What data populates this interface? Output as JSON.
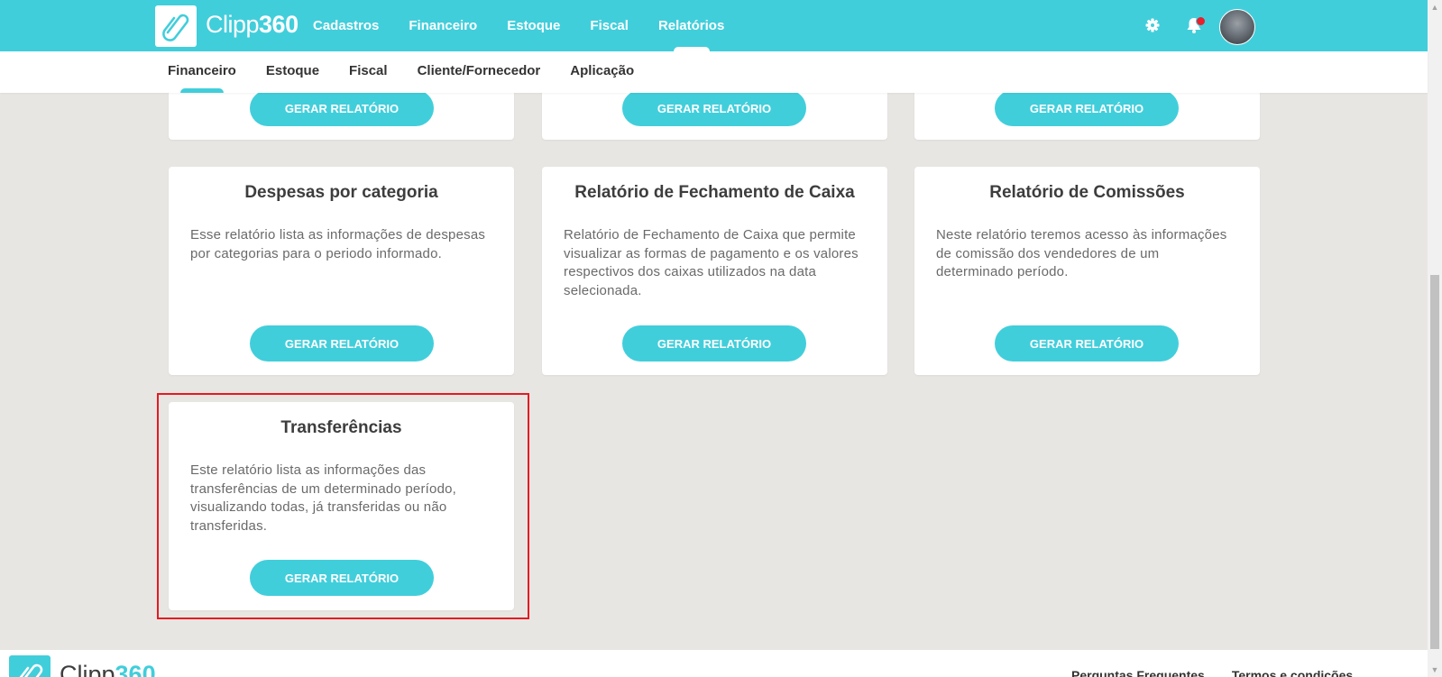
{
  "brand": {
    "name": "Clipp",
    "number": "360"
  },
  "top_nav": [
    {
      "label": "Cadastros",
      "active": false
    },
    {
      "label": "Financeiro",
      "active": false
    },
    {
      "label": "Estoque",
      "active": false
    },
    {
      "label": "Fiscal",
      "active": false
    },
    {
      "label": "Relatórios",
      "active": true
    }
  ],
  "sub_nav": [
    {
      "label": "Financeiro",
      "active": true
    },
    {
      "label": "Estoque",
      "active": false
    },
    {
      "label": "Fiscal",
      "active": false
    },
    {
      "label": "Cliente/Fornecedor",
      "active": false
    },
    {
      "label": "Aplicação",
      "active": false
    }
  ],
  "header_icons": {
    "settings": "gear-icon",
    "notifications": "bell-icon",
    "has_notification": true
  },
  "button_label": "GERAR RELATÓRIO",
  "cards": [
    {
      "title": "Despesas por categoria",
      "description": "Esse relatório lista as informações de despesas por categorias para o periodo informado."
    },
    {
      "title": "Relatório de Fechamento de Caixa",
      "description": "Relatório de Fechamento de Caixa que permite visualizar as formas de pagamento e os valores respectivos dos caixas utilizados na data selecionada."
    },
    {
      "title": "Relatório de Comissões",
      "description": "Neste relatório teremos acesso às informações de comissão dos vendedores de um determinado período."
    },
    {
      "title": "Transferências",
      "description": "Este relatório lista as informações das transferências de um determinado período, visualizando todas, já transferidas ou não transferidas."
    }
  ],
  "footer": {
    "links": [
      "Perguntas Frequentes",
      "Termos e condições"
    ]
  },
  "colors": {
    "accent": "#41cedb",
    "highlight": "#e31b23",
    "background": "#e8e6e3"
  }
}
